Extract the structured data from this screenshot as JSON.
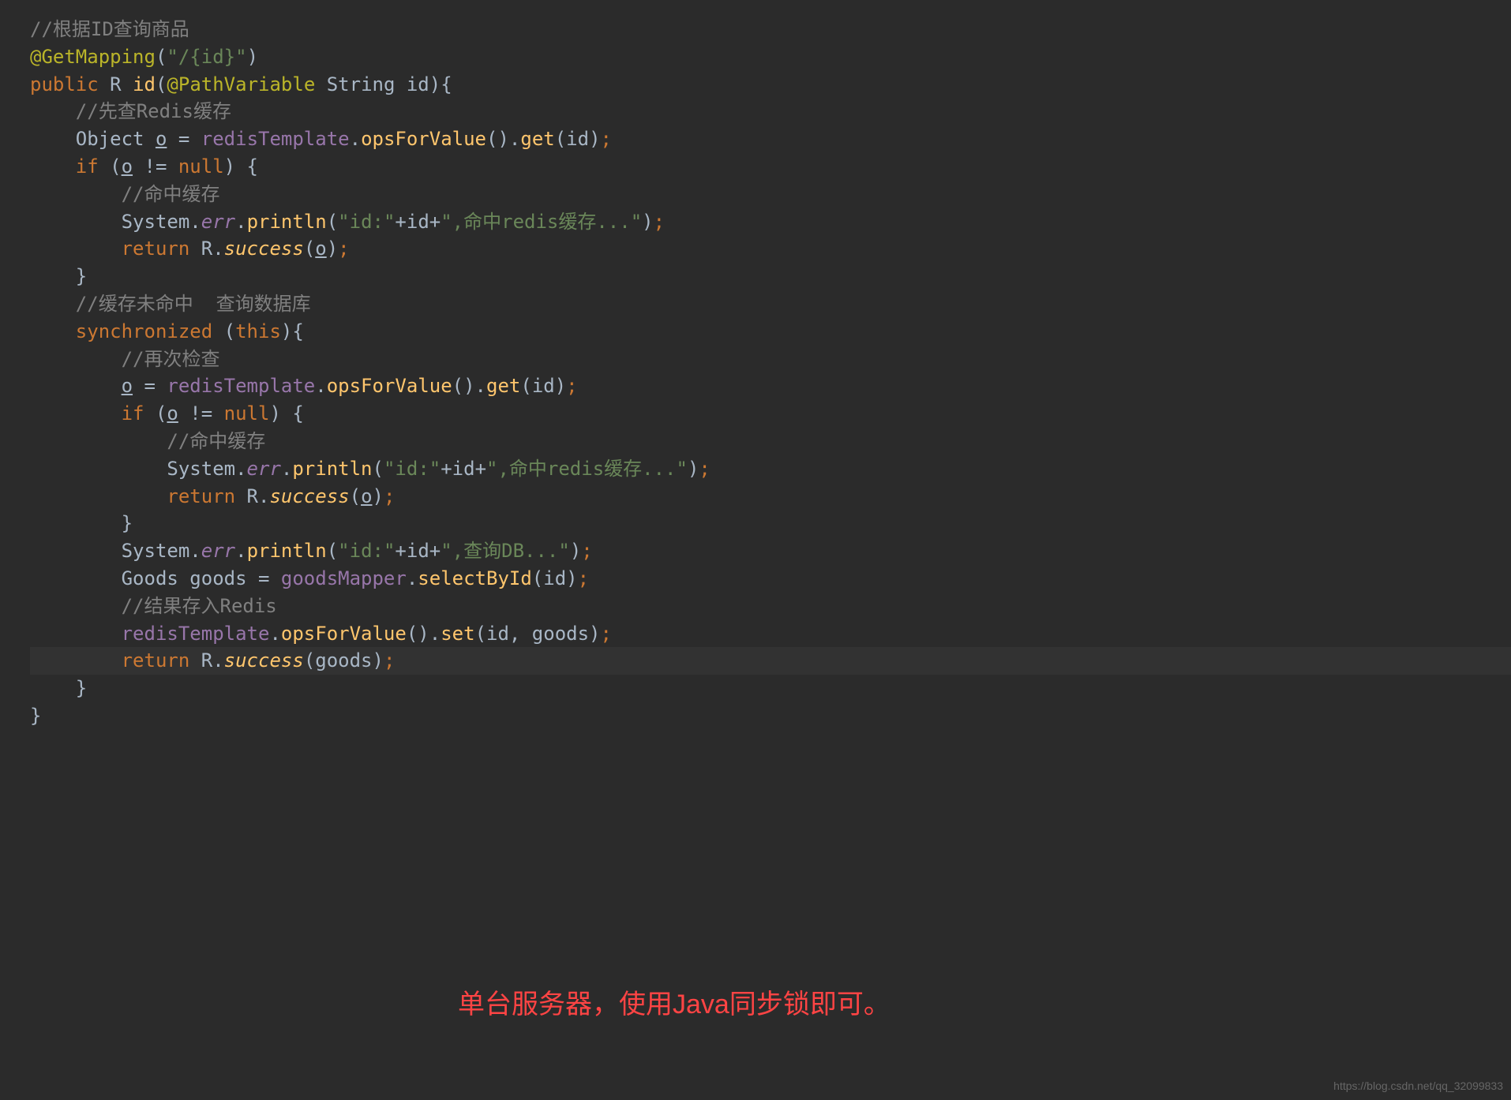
{
  "code": {
    "line1_comment": "//根据ID查询商品",
    "line2_annotation": "@GetMapping",
    "line2_paren_open": "(",
    "line2_string": "\"/{id}\"",
    "line2_paren_close": ")",
    "line3_public": "public",
    "line3_type": " R ",
    "line3_method": "id",
    "line3_open": "(",
    "line3_anno": "@PathVariable",
    "line3_ptype": " String id",
    "line3_close": "){",
    "line4_comment": "    //先查Redis缓存",
    "line5_pre": "    Object ",
    "line5_var": "o",
    "line5_eq": " = ",
    "line5_field": "redisTemplate",
    "line5_dot": ".",
    "line5_m1": "opsForValue",
    "line5_p1": "().",
    "line5_m2": "get",
    "line5_p2": "(id)",
    "line5_semi": ";",
    "line6_if": "    if ",
    "line6_open": "(",
    "line6_var": "o",
    "line6_ne": " != ",
    "line6_null": "null",
    "line6_close": ") {",
    "line7_comment": "        //命中缓存",
    "line8_pre": "        System.",
    "line8_err": "err",
    "line8_dot": ".",
    "line8_m": "println",
    "line8_open": "(",
    "line8_s1": "\"id:\"",
    "line8_plus1": "+id+",
    "line8_s2": "\",命中redis缓存...\"",
    "line8_close": ")",
    "line8_semi": ";",
    "line9_ret": "        return ",
    "line9_r": "R.",
    "line9_m": "success",
    "line9_open": "(",
    "line9_var": "o",
    "line9_close": ")",
    "line9_semi": ";",
    "line10": "    }",
    "line11_comment": "    //缓存未命中  查询数据库",
    "line12_sync": "    synchronized ",
    "line12_open": "(",
    "line12_this": "this",
    "line12_close": "){",
    "line13_comment": "        //再次检查",
    "line14_pre": "        ",
    "line14_var": "o",
    "line14_eq": " = ",
    "line14_field": "redisTemplate",
    "line14_dot": ".",
    "line14_m1": "opsForValue",
    "line14_p1": "().",
    "line14_m2": "get",
    "line14_p2": "(id)",
    "line14_semi": ";",
    "line15_if": "        if ",
    "line15_open": "(",
    "line15_var": "o",
    "line15_ne": " != ",
    "line15_null": "null",
    "line15_close": ") {",
    "line16_comment": "            //命中缓存",
    "line17_pre": "            System.",
    "line17_err": "err",
    "line17_dot": ".",
    "line17_m": "println",
    "line17_open": "(",
    "line17_s1": "\"id:\"",
    "line17_plus1": "+id+",
    "line17_s2": "\",命中redis缓存...\"",
    "line17_close": ")",
    "line17_semi": ";",
    "line18_ret": "            return ",
    "line18_r": "R.",
    "line18_m": "success",
    "line18_open": "(",
    "line18_var": "o",
    "line18_close": ")",
    "line18_semi": ";",
    "line19": "        }",
    "line20_pre": "        System.",
    "line20_err": "err",
    "line20_dot": ".",
    "line20_m": "println",
    "line20_open": "(",
    "line20_s1": "\"id:\"",
    "line20_plus1": "+id+",
    "line20_s2": "\",查询DB...\"",
    "line20_close": ")",
    "line20_semi": ";",
    "line21_pre": "        Goods goods = ",
    "line21_field": "goodsMapper",
    "line21_dot": ".",
    "line21_m": "selectById",
    "line21_p": "(id)",
    "line21_semi": ";",
    "line22_comment": "        //结果存入Redis",
    "line23_pre": "        ",
    "line23_field": "redisTemplate",
    "line23_dot": ".",
    "line23_m1": "opsForValue",
    "line23_p1": "().",
    "line23_m2": "set",
    "line23_p2": "(id, goods)",
    "line23_semi": ";",
    "line24_ret": "        return ",
    "line24_r": "R.",
    "line24_m": "success",
    "line24_p": "(goods)",
    "line24_semi": ";",
    "line25": "    }",
    "line26": "}"
  },
  "annotation": "单台服务器，使用Java同步锁即可。",
  "watermark": "https://blog.csdn.net/qq_32099833"
}
